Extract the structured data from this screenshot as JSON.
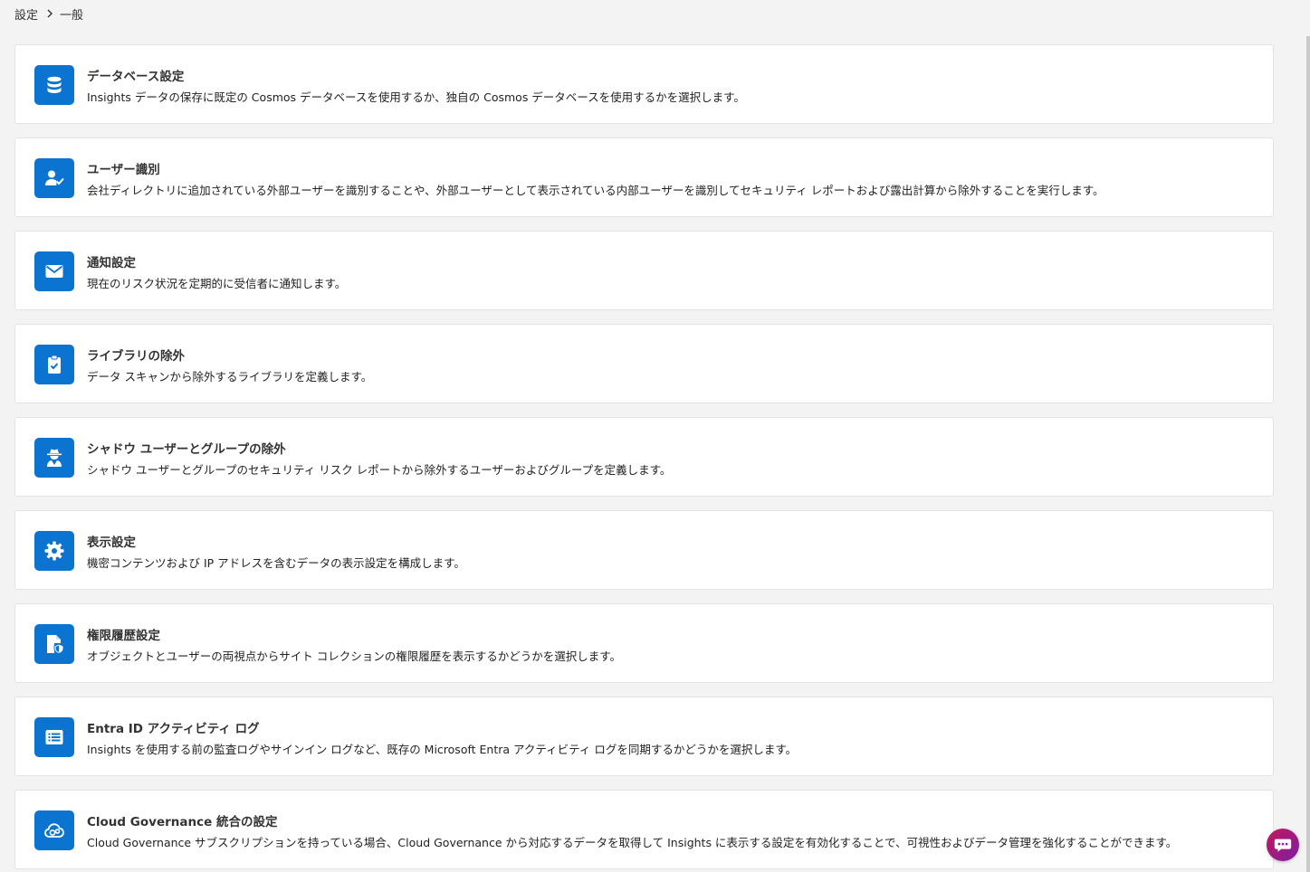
{
  "breadcrumb": {
    "parent": "設定",
    "current": "一般"
  },
  "colors": {
    "accent": "#0b74d1",
    "background": "#f3f3f3",
    "card": "#ffffff"
  },
  "cards": [
    {
      "icon": "database-icon",
      "title": "データベース設定",
      "description": "Insights データの保存に既定の Cosmos データベースを使用するか、独自の Cosmos データベースを使用するかを選択します。"
    },
    {
      "icon": "user-check-icon",
      "title": "ユーザー識別",
      "description": "会社ディレクトリに追加されている外部ユーザーを識別することや、外部ユーザーとして表示されている内部ユーザーを識別してセキュリティ レポートおよび露出計算から除外することを実行します。"
    },
    {
      "icon": "envelope-icon",
      "title": "通知設定",
      "description": "現在のリスク状況を定期的に受信者に通知します。"
    },
    {
      "icon": "clipboard-check-icon",
      "title": "ライブラリの除外",
      "description": "データ スキャンから除外するライブラリを定義します。"
    },
    {
      "icon": "user-secret-icon",
      "title": "シャドウ ユーザーとグループの除外",
      "description": "シャドウ ユーザーとグループのセキュリティ リスク レポートから除外するユーザーおよびグループを定義します。"
    },
    {
      "icon": "gear-icon",
      "title": "表示設定",
      "description": "機密コンテンツおよび IP アドレスを含むデータの表示設定を構成します。"
    },
    {
      "icon": "file-shield-icon",
      "title": "権限履歴設定",
      "description": "オブジェクトとユーザーの両視点からサイト コレクションの権限履歴を表示するかどうかを選択します。"
    },
    {
      "icon": "list-icon",
      "title": "Entra ID アクティビティ ログ",
      "description": "Insights を使用する前の監査ログやサインイン ログなど、既存の Microsoft Entra アクティビティ ログを同期するかどうかを選択します。"
    },
    {
      "icon": "cloud-gear-icon",
      "title": "Cloud Governance 統合の設定",
      "description": "Cloud Governance サブスクリプションを持っている場合、Cloud Governance から対応するデータを取得して Insights に表示する設定を有効化することで、可視性およびデータ管理を強化することができます。"
    }
  ],
  "chat": {
    "icon": "chat-bubble-icon"
  }
}
